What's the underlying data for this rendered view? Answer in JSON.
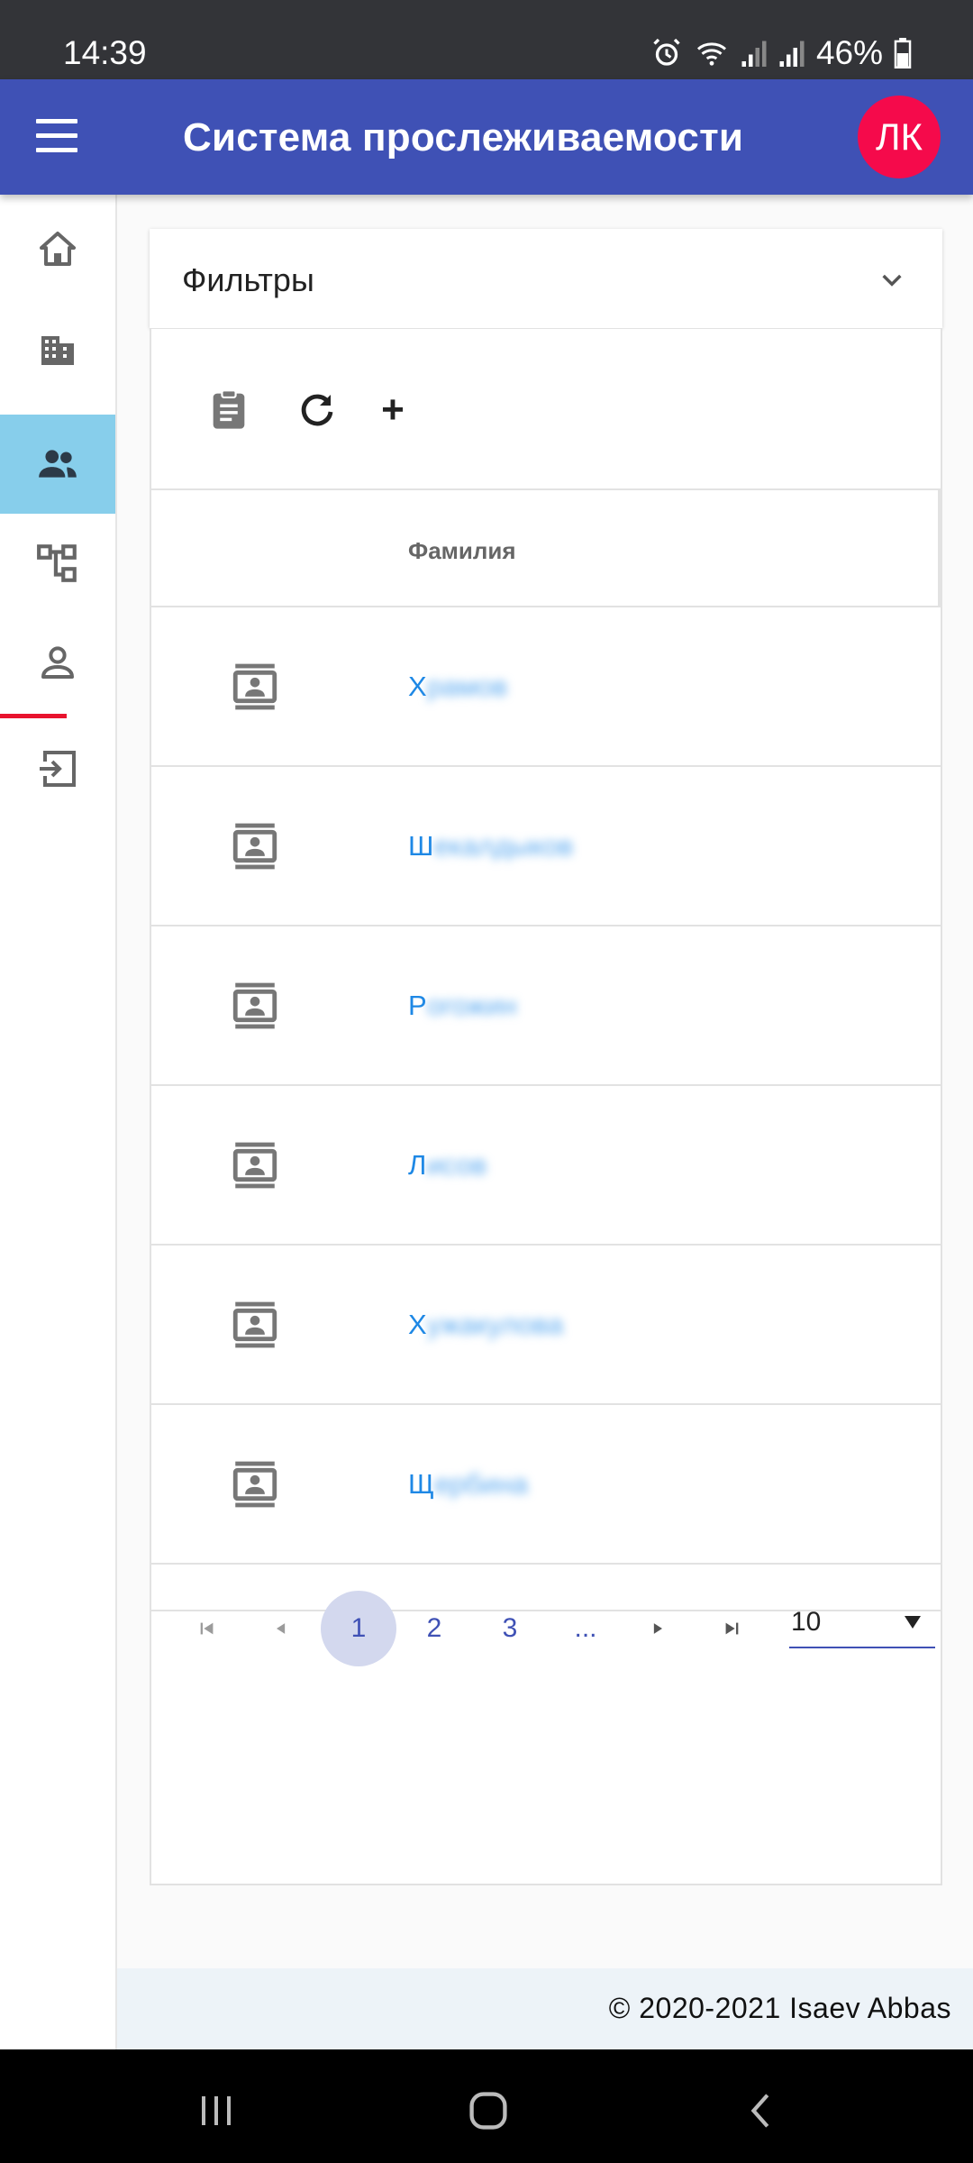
{
  "status": {
    "time": "14:39",
    "battery": "46%"
  },
  "appbar": {
    "title": "Система прослеживаемости",
    "avatar": "ЛК"
  },
  "sidebar": {
    "items": [
      {
        "icon": "home-icon"
      },
      {
        "icon": "building-icon"
      },
      {
        "icon": "people-icon",
        "active": true
      },
      {
        "icon": "hierarchy-icon"
      },
      {
        "icon": "person-icon"
      },
      {
        "icon": "logout-icon"
      }
    ]
  },
  "filters": {
    "label": "Фильтры"
  },
  "toolbar": {
    "add_label": "+"
  },
  "table": {
    "header": "Фамилия",
    "rows": [
      {
        "initial": "Х",
        "rest": "рамов"
      },
      {
        "initial": "Ш",
        "rest": "екалдыков"
      },
      {
        "initial": "Р",
        "rest": "огожин"
      },
      {
        "initial": "Л",
        "rest": "исов"
      },
      {
        "initial": "Х",
        "rest": "ужакулова"
      },
      {
        "initial": "Щ",
        "rest": "ербина"
      }
    ]
  },
  "pager": {
    "pages": [
      "1",
      "2",
      "3",
      "..."
    ],
    "current": "1",
    "page_size": "10"
  },
  "footer": {
    "text": "© 2020-2021 Isaev Abbas"
  }
}
